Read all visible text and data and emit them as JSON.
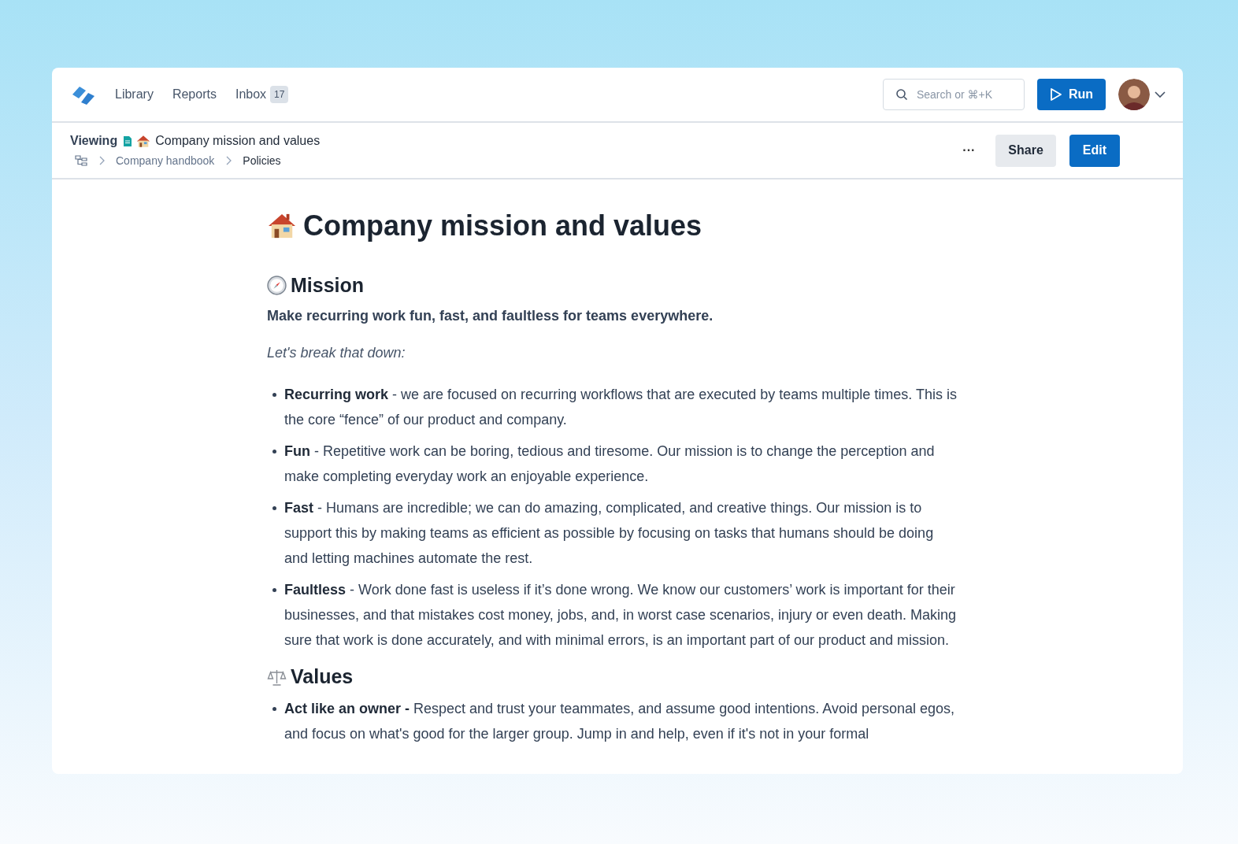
{
  "nav": {
    "items": [
      {
        "label": "Library"
      },
      {
        "label": "Reports"
      },
      {
        "label": "Inbox",
        "badge": "17"
      }
    ],
    "search": {
      "placeholder": "Search or ⌘+K"
    },
    "run_button": "Run"
  },
  "toolbar": {
    "viewing_label": "Viewing",
    "doc_title": "Company mission and values",
    "breadcrumbs": [
      "Company handbook",
      "Policies"
    ],
    "more_button": "···",
    "share_button": "Share",
    "edit_button": "Edit"
  },
  "document": {
    "title": "Company mission and values",
    "sections": [
      {
        "kind": "mission",
        "heading": "Mission",
        "lead": "Make recurring work fun, fast, and faultless for teams everywhere.",
        "intro": "Let's break that down:",
        "bullets": [
          "**Recurring work** - we are focused on recurring workflows that are executed by teams multiple times. This is the core “fence” of our product and company.",
          "**Fun** - Repetitive work can be boring, tedious and tiresome. Our mission is to change the perception and make completing everyday work an enjoyable experience.",
          "**Fast** - Humans are incredible; we can do amazing, complicated, and creative things. Our mission is to support this by making teams as efficient as possible by focusing on tasks that humans should be doing and letting machines automate the rest.",
          "**Faultless** - Work done fast is useless if it’s done wrong. We know our customers’ work is important for their businesses, and that mistakes cost money, jobs, and, in worst case scenarios, injury or even death. Making sure that work is done accurately, and with minimal errors, is an important part of our product and mission."
        ]
      },
      {
        "kind": "values",
        "heading": "Values",
        "bullets": [
          "**Act like an owner -** Respect and trust your teammates, and assume good intentions. Avoid personal egos, and focus on what's good for the larger group. Jump in and help, even if it's not in your formal"
        ]
      }
    ]
  }
}
